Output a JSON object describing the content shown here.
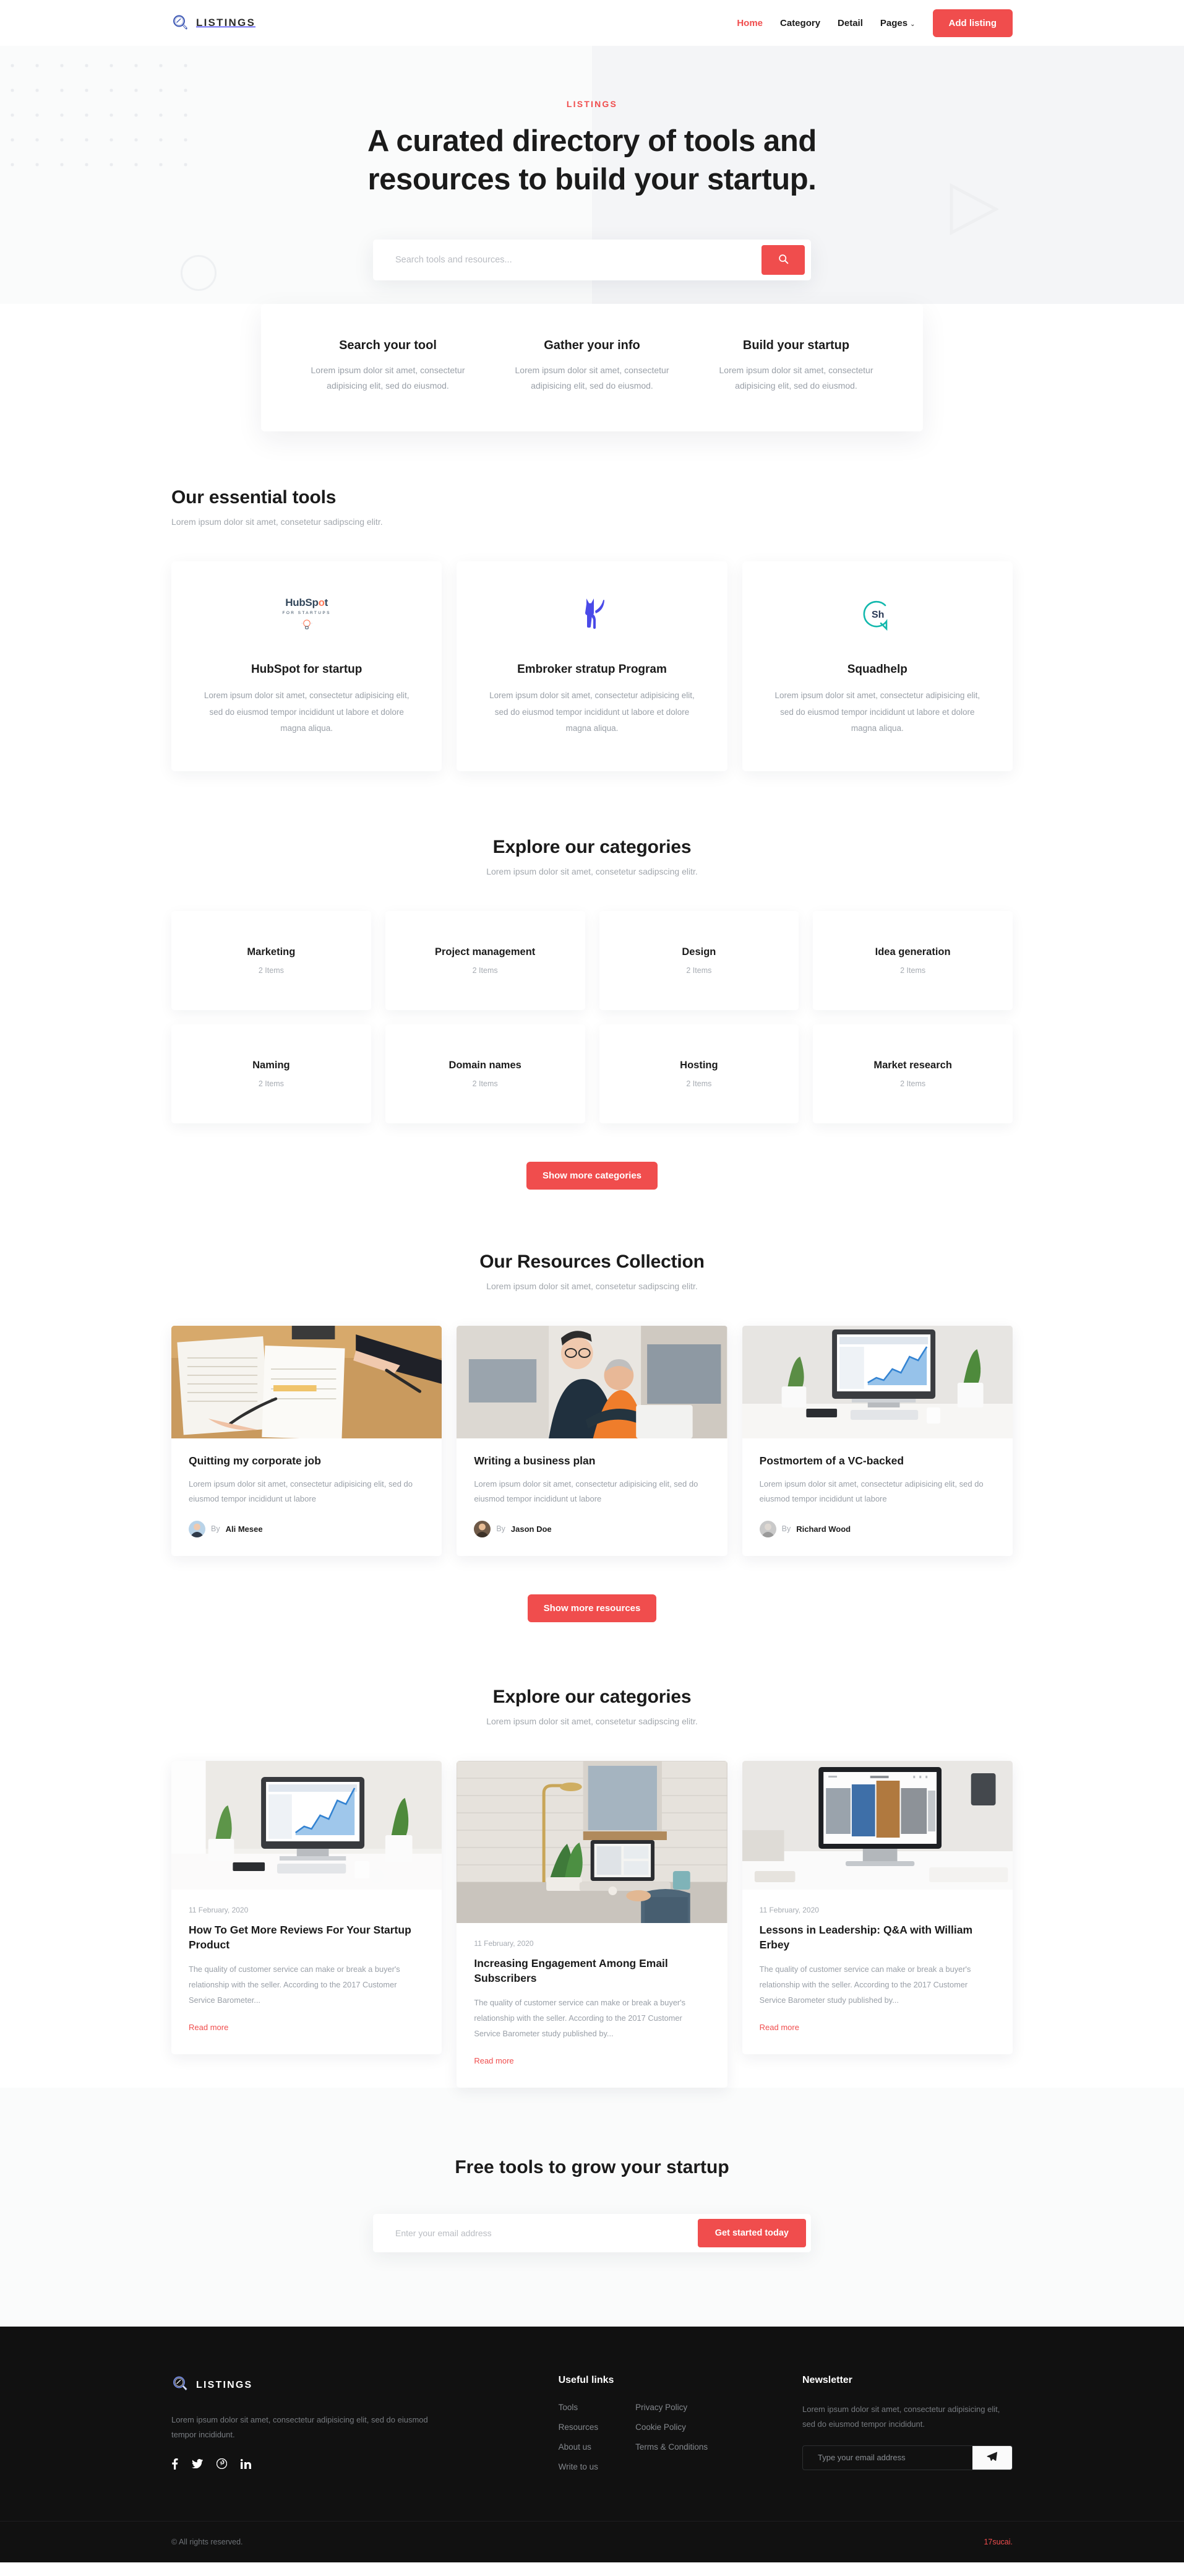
{
  "theme": {
    "accent": "#f04d4d",
    "dark": "#111111",
    "light_bg": "#fafbfb",
    "hero_right_bg": "#f4f5f7"
  },
  "navbar": {
    "brand": "LISTINGS",
    "links": [
      {
        "label": "Home",
        "active": true
      },
      {
        "label": "Category",
        "active": false
      },
      {
        "label": "Detail",
        "active": false
      },
      {
        "label": "Pages",
        "active": false,
        "has_caret": true
      }
    ],
    "cta_label": "Add listing"
  },
  "hero": {
    "eyebrow": "LISTINGS",
    "title_line1": "A curated directory of tools and",
    "title_line2": "resources to build your startup.",
    "search_placeholder": "Search tools and resources...",
    "search_value": "",
    "search_icon": "search-icon"
  },
  "steps": [
    {
      "title": "Search your tool",
      "desc": "Lorem ipsum dolor sit amet, consectetur adipisicing elit, sed do eiusmod."
    },
    {
      "title": "Gather your info",
      "desc": "Lorem ipsum dolor sit amet, consectetur adipisicing elit, sed do eiusmod."
    },
    {
      "title": "Build your startup",
      "desc": "Lorem ipsum dolor sit amet, consectetur adipisicing elit, sed do eiusmod."
    }
  ],
  "tools_section": {
    "title": "Our essential tools",
    "subtitle": "Lorem ipsum dolor sit amet, consetetur sadipscing elitr.",
    "items": [
      {
        "logo": "hubspot-for-startups-logo",
        "name": "HubSpot for startup",
        "desc": "Lorem ipsum dolor sit amet, consectetur adipisicing elit, sed do eiusmod tempor incididunt ut labore et dolore magna aliqua."
      },
      {
        "logo": "embroker-dog-logo",
        "name": "Embroker stratup Program",
        "desc": "Lorem ipsum dolor sit amet, consectetur adipisicing elit, sed do eiusmod tempor incididunt ut labore et dolore magna aliqua."
      },
      {
        "logo": "squadhelp-logo",
        "name": "Squadhelp",
        "desc": "Lorem ipsum dolor sit amet, consectetur adipisicing elit, sed do eiusmod tempor incididunt ut labore et dolore magna aliqua."
      }
    ]
  },
  "categories_section": {
    "title": "Explore our categories",
    "subtitle": "Lorem ipsum dolor sit amet, consetetur sadipscing elitr.",
    "items": [
      {
        "name": "Marketing",
        "count": "2 Items"
      },
      {
        "name": "Project management",
        "count": "2 Items"
      },
      {
        "name": "Design",
        "count": "2 Items"
      },
      {
        "name": "Idea generation",
        "count": "2 Items"
      },
      {
        "name": "Naming",
        "count": "2 Items"
      },
      {
        "name": "Domain names",
        "count": "2 Items"
      },
      {
        "name": "Hosting",
        "count": "2 Items"
      },
      {
        "name": "Market research",
        "count": "2 Items"
      }
    ],
    "more_button": "Show more categories"
  },
  "resources_section": {
    "title": "Our Resources Collection",
    "subtitle": "Lorem ipsum dolor sit amet, consetetur sadipscing elitr.",
    "items": [
      {
        "image": "desk-paperwork-photo",
        "title": "Quitting my corporate job",
        "desc": "Lorem ipsum dolor sit amet, consectetur adipisicing elit, sed do eiusmod tempor incididunt ut labore",
        "by": "By",
        "author": "Ali Mesee"
      },
      {
        "image": "office-colleagues-photo",
        "title": "Writing a business plan",
        "desc": "Lorem ipsum dolor sit amet, consectetur adipisicing elit, sed do eiusmod tempor incididunt ut labore",
        "by": "By",
        "author": "Jason Doe"
      },
      {
        "image": "imac-desk-chart-photo",
        "title": "Postmortem of a VC-backed",
        "desc": "Lorem ipsum dolor sit amet, consectetur adipisicing elit, sed do eiusmod tempor incididunt ut labore",
        "by": "By",
        "author": "Richard Wood"
      }
    ],
    "more_button": "Show more resources"
  },
  "blog_section": {
    "title": "Explore our categories",
    "subtitle": "Lorem ipsum dolor sit amet, consetetur sadipscing elitr.",
    "items": [
      {
        "image": "imac-plants-desk-photo",
        "date": "11 February, 2020",
        "title": "How To Get More Reviews For Your Startup Product",
        "desc": "The quality of customer service can make or break a buyer's relationship with the seller. According to the 2017 Customer Service Barometer...",
        "link": "Read more"
      },
      {
        "image": "brick-wall-workspace-photo",
        "date": "11 February, 2020",
        "title": "Increasing Engagement Among Email Subscribers",
        "desc": "The quality of customer service can make or break a buyer's relationship with the seller. According to the 2017 Customer Service Barometer study published by...",
        "link": "Read more"
      },
      {
        "image": "imac-gallery-screen-photo",
        "date": "11 February, 2020",
        "title": "Lessons in Leadership: Q&A with William Erbey",
        "desc": "The quality of customer service can make or break a buyer's relationship with the seller. According to the 2017 Customer Service Barometer study published by...",
        "link": "Read more"
      }
    ]
  },
  "cta": {
    "title": "Free tools to grow your startup",
    "placeholder": "Enter your email address",
    "value": "",
    "button": "Get started today"
  },
  "footer": {
    "brand": "LISTINGS",
    "description": "Lorem ipsum dolor sit amet, consectetur adipisicing elit, sed do eiusmod tempor incididunt.",
    "social": [
      {
        "name": "facebook-icon",
        "glyph": "f"
      },
      {
        "name": "twitter-icon",
        "glyph": "t"
      },
      {
        "name": "pinterest-icon",
        "glyph": "p"
      },
      {
        "name": "linkedin-icon",
        "glyph": "in"
      }
    ],
    "links_title": "Useful links",
    "links_col1": [
      "Tools",
      "Resources",
      "About us",
      "Write to us"
    ],
    "links_col2": [
      "Privacy Policy",
      "Cookie Policy",
      "Terms & Conditions"
    ],
    "newsletter_title": "Newsletter",
    "newsletter_desc": "Lorem ipsum dolor sit amet, consectetur adipisicing elit, sed do eiusmod tempor incididunt.",
    "newsletter_placeholder": "Type your email address",
    "newsletter_value": "",
    "send_icon": "paper-plane-icon",
    "copyright": "© All rights reserved.",
    "credit": "17sucai."
  }
}
